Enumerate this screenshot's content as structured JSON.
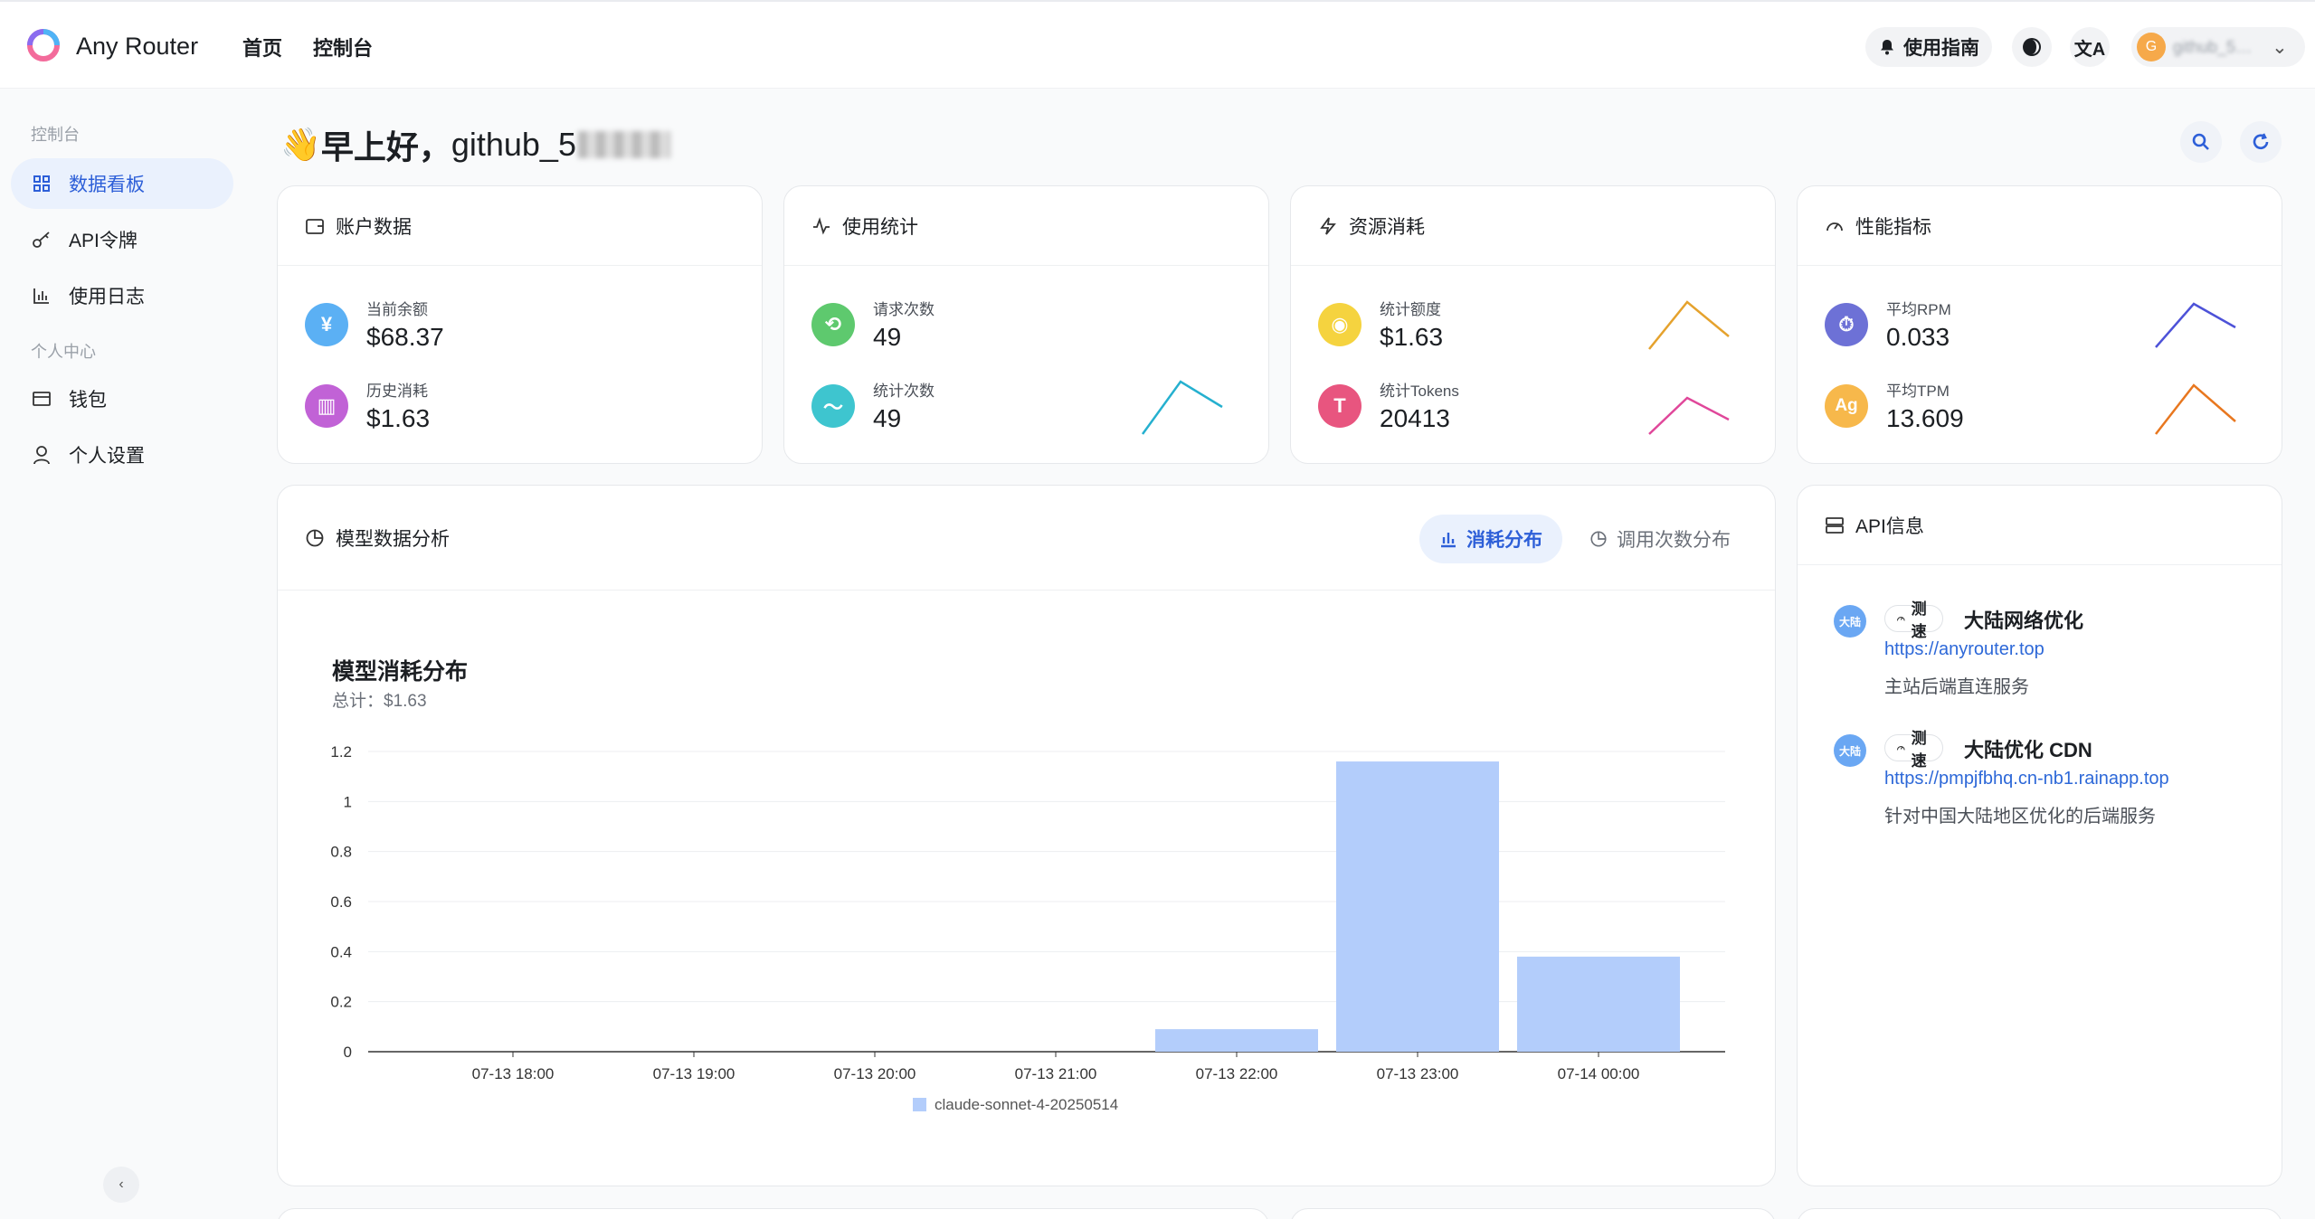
{
  "header": {
    "app_title": "Any Router",
    "nav": [
      "首页",
      "控制台"
    ],
    "guide_label": "使用指南",
    "lang_icon": "文A",
    "user_initial": "G",
    "user_name": "github_5…"
  },
  "sidebar": {
    "group1": "控制台",
    "group2": "个人中心",
    "items": [
      {
        "label": "数据看板",
        "icon": "grid-icon",
        "active": true
      },
      {
        "label": "API令牌",
        "icon": "key-icon"
      },
      {
        "label": "使用日志",
        "icon": "bar-chart-icon"
      },
      {
        "label": "钱包",
        "icon": "wallet-icon"
      },
      {
        "label": "个人设置",
        "icon": "user-icon"
      }
    ]
  },
  "greeting": {
    "emoji": "👋",
    "text": "早上好，",
    "username": "github_5"
  },
  "cards": {
    "account": {
      "title": "账户数据",
      "balance_label": "当前余额",
      "balance_value": "$68.37",
      "spent_label": "历史消耗",
      "spent_value": "$1.63"
    },
    "usage": {
      "title": "使用统计",
      "requests_label": "请求次数",
      "requests_value": "49",
      "count_label": "统计次数",
      "count_value": "49"
    },
    "resource": {
      "title": "资源消耗",
      "quota_label": "统计额度",
      "quota_value": "$1.63",
      "tokens_label": "统计Tokens",
      "tokens_value": "20413"
    },
    "performance": {
      "title": "性能指标",
      "rpm_label": "平均RPM",
      "rpm_value": "0.033",
      "tpm_label": "平均TPM",
      "tpm_value": "13.609",
      "tpm_icon_text": "Ag"
    }
  },
  "colors": {
    "accent": "#2d5fd8",
    "bar": "#b3cdfb",
    "spark_usage": "#25b0cf",
    "spark_quota": "#e5a22d",
    "spark_tokens": "#e0479a",
    "spark_rpm": "#4d52d8",
    "spark_tpm": "#e8771f"
  },
  "model_analysis": {
    "title": "模型数据分析",
    "tab_active": "消耗分布",
    "tab_inactive": "调用次数分布",
    "chart_title": "模型消耗分布",
    "chart_subtitle": "总计：$1.63"
  },
  "chart_data": {
    "type": "bar",
    "title": "模型消耗分布",
    "subtitle": "总计：$1.63",
    "categories": [
      "07-13 18:00",
      "07-13 19:00",
      "07-13 20:00",
      "07-13 21:00",
      "07-13 22:00",
      "07-13 23:00",
      "07-14 00:00"
    ],
    "series": [
      {
        "name": "claude-sonnet-4-20250514",
        "values": [
          0,
          0,
          0,
          0,
          0.09,
          1.16,
          0.38
        ]
      }
    ],
    "yticks": [
      "0",
      "0.2",
      "0.4",
      "0.6",
      "0.8",
      "1",
      "1.2"
    ],
    "ylim": [
      0,
      1.2
    ],
    "grid": true,
    "legend": "bottom"
  },
  "api_info": {
    "title": "API信息",
    "test_label": "测速",
    "entries": [
      {
        "badge": "大陆",
        "name": "大陆网络优化",
        "url": "https://anyrouter.top",
        "desc": "主站后端直连服务"
      },
      {
        "badge": "大陆",
        "name": "大陆优化 CDN",
        "url": "https://pmpjfbhq.cn-nb1.rainapp.top",
        "desc": "针对中国大陆地区优化的后端服务"
      }
    ]
  }
}
